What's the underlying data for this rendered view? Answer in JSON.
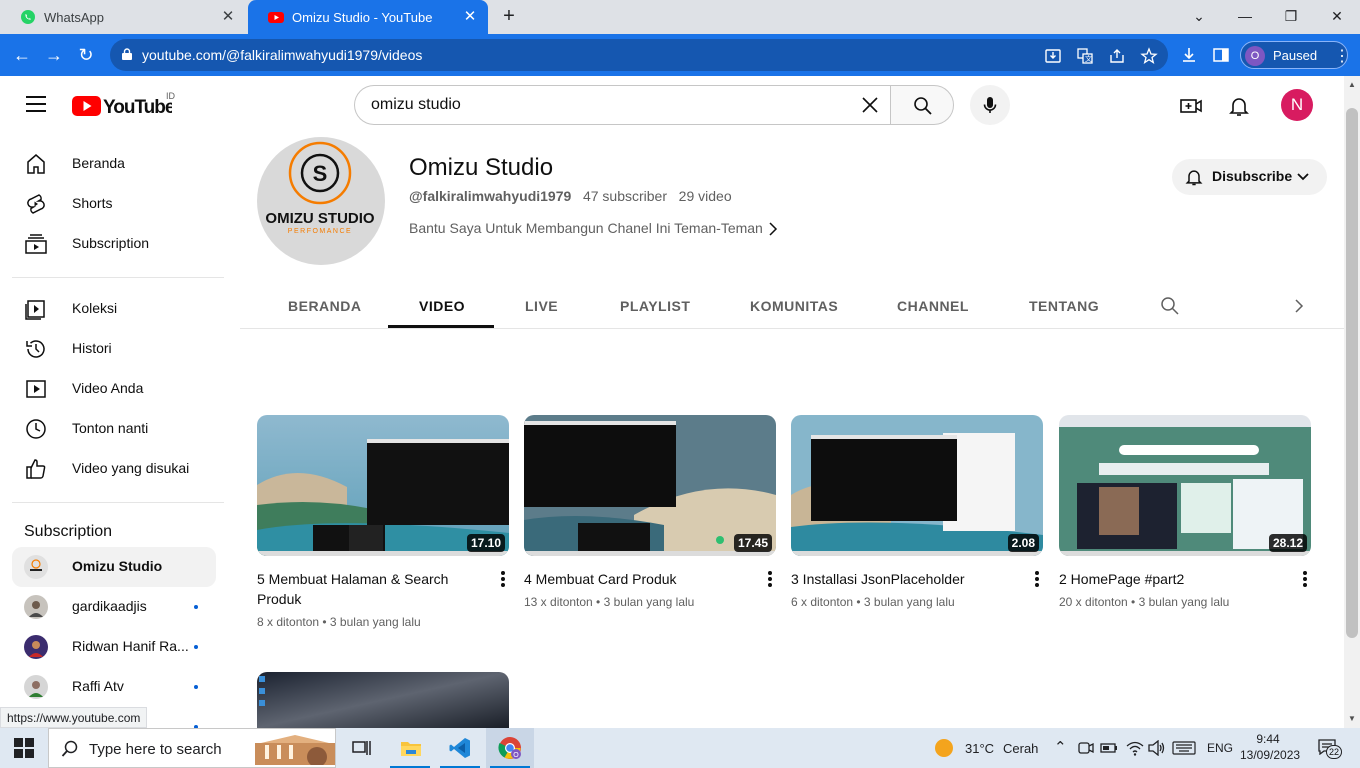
{
  "browser": {
    "tabs": [
      {
        "title": "WhatsApp",
        "icon": "whatsapp-icon"
      },
      {
        "title": "Omizu Studio - YouTube",
        "icon": "youtube-icon",
        "active": true
      }
    ],
    "url": "youtube.com/@falkiralimwahyudi1979/videos",
    "profile_initial": "O",
    "profile_status": "Paused",
    "accent": "#1a73e8"
  },
  "yt_header": {
    "logo_text": "YouTube",
    "country_code": "ID",
    "search_value": "omizu studio",
    "user_initial": "N"
  },
  "sidebar": {
    "main": [
      {
        "label": "Beranda",
        "icon": "home-icon"
      },
      {
        "label": "Shorts",
        "icon": "shorts-icon"
      },
      {
        "label": "Subscription",
        "icon": "subscriptions-icon"
      }
    ],
    "library": [
      {
        "label": "Koleksi",
        "icon": "library-icon"
      },
      {
        "label": "Histori",
        "icon": "history-icon"
      },
      {
        "label": "Video Anda",
        "icon": "your-videos-icon"
      },
      {
        "label": "Tonton nanti",
        "icon": "watch-later-icon"
      },
      {
        "label": "Video yang disukai",
        "icon": "liked-icon"
      }
    ],
    "subscriptions_heading": "Subscription",
    "subscriptions": [
      {
        "label": "Omizu Studio",
        "active": true,
        "new": false
      },
      {
        "label": "gardikaadjis",
        "new": true
      },
      {
        "label": "Ridwan Hanif Ra...",
        "new": true
      },
      {
        "label": "Raffi Atv",
        "new": true
      }
    ]
  },
  "channel": {
    "name": "Omizu Studio",
    "handle": "@falkiralimwahyudi1979",
    "subscribers": "47 subscriber",
    "videos_count": "29 video",
    "description": "Bantu Saya Untuk Membangun Chanel Ini Teman-Teman",
    "logo_letter": "S",
    "logo_title": "OMIZU STUDIO",
    "logo_subtitle": "PERFOMANCE",
    "subscribe_button": "Disubscribe",
    "tabs": [
      "BERANDA",
      "VIDEO",
      "LIVE",
      "PLAYLIST",
      "KOMUNITAS",
      "CHANNEL",
      "TENTANG"
    ],
    "active_tab": "VIDEO"
  },
  "videos": [
    {
      "title": "5 Membuat Halaman & Search Produk",
      "duration": "17.10",
      "views": "8 x ditonton",
      "age": "3 bulan yang lalu"
    },
    {
      "title": "4 Membuat Card Produk",
      "duration": "17.45",
      "views": "13 x ditonton",
      "age": "3 bulan yang lalu"
    },
    {
      "title": "3 Installasi JsonPlaceholder",
      "duration": "2.08",
      "views": "6 x ditonton",
      "age": "3 bulan yang lalu"
    },
    {
      "title": "2 HomePage #part2",
      "duration": "28.12",
      "views": "20 x ditonton",
      "age": "3 bulan yang lalu"
    }
  ],
  "status_url": "https://www.youtube.com",
  "taskbar": {
    "search_placeholder": "Type here to search",
    "weather_temp": "31°C",
    "weather_desc": "Cerah",
    "language": "ENG",
    "time": "9:44",
    "date": "13/09/2023",
    "notifications": "22"
  }
}
